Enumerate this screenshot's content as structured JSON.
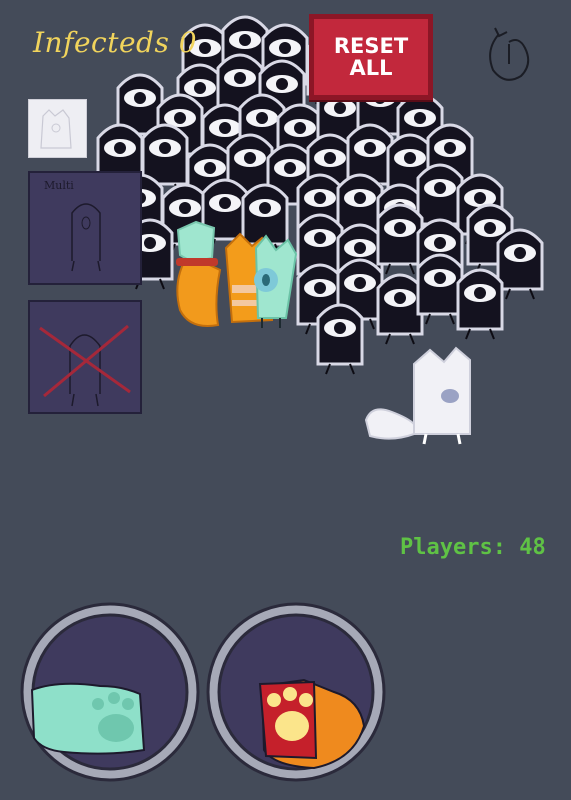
{
  "hud": {
    "infected_label": "Infecteds 0",
    "players_label": "Players: 48",
    "reset_label": "RESET\nALL",
    "panel_multi_label": "Multi"
  },
  "icons": {
    "rotate": "rotate-arrow-icon",
    "multi": "ghost-multi-icon",
    "hide": "ghost-crossed-icon",
    "left_ability": "paw-print-mint-icon",
    "right_ability": "paw-print-fire-icon"
  },
  "colors": {
    "background": "#444b59",
    "infected_text": "#f1d45c",
    "players_text": "#5fc245",
    "reset_button": "#c2283c",
    "panel": "#3f3a5e",
    "ghost_body": "#14121f",
    "ghost_edge": "#d9d9e6",
    "joystick_ring": "#a6a9b7",
    "joystick_fill": "#3f3a5e"
  },
  "ghost_count_visible": 46
}
